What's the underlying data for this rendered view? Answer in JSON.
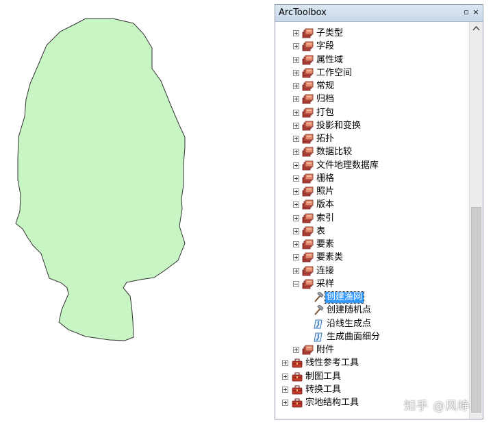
{
  "toolbox": {
    "title": "ArcToolbox",
    "maximize_glyph": "▫",
    "close_glyph": "×"
  },
  "tree": {
    "items": [
      {
        "label": "子类型",
        "level": 1,
        "icon": "toolset-icon",
        "expander": "plus"
      },
      {
        "label": "字段",
        "level": 1,
        "icon": "toolset-icon",
        "expander": "plus"
      },
      {
        "label": "属性域",
        "level": 1,
        "icon": "toolset-icon",
        "expander": "plus"
      },
      {
        "label": "工作空间",
        "level": 1,
        "icon": "toolset-icon",
        "expander": "plus"
      },
      {
        "label": "常规",
        "level": 1,
        "icon": "toolset-icon",
        "expander": "plus"
      },
      {
        "label": "归档",
        "level": 1,
        "icon": "toolset-icon",
        "expander": "plus"
      },
      {
        "label": "打包",
        "level": 1,
        "icon": "toolset-icon",
        "expander": "plus"
      },
      {
        "label": "投影和变换",
        "level": 1,
        "icon": "toolset-icon",
        "expander": "plus"
      },
      {
        "label": "拓扑",
        "level": 1,
        "icon": "toolset-icon",
        "expander": "plus"
      },
      {
        "label": "数据比较",
        "level": 1,
        "icon": "toolset-icon",
        "expander": "plus"
      },
      {
        "label": "文件地理数据库",
        "level": 1,
        "icon": "toolset-icon",
        "expander": "plus"
      },
      {
        "label": "栅格",
        "level": 1,
        "icon": "toolset-icon",
        "expander": "plus"
      },
      {
        "label": "照片",
        "level": 1,
        "icon": "toolset-icon",
        "expander": "plus"
      },
      {
        "label": "版本",
        "level": 1,
        "icon": "toolset-icon",
        "expander": "plus"
      },
      {
        "label": "索引",
        "level": 1,
        "icon": "toolset-icon",
        "expander": "plus"
      },
      {
        "label": "表",
        "level": 1,
        "icon": "toolset-icon",
        "expander": "plus"
      },
      {
        "label": "要素",
        "level": 1,
        "icon": "toolset-icon",
        "expander": "plus"
      },
      {
        "label": "要素类",
        "level": 1,
        "icon": "toolset-icon",
        "expander": "plus"
      },
      {
        "label": "连接",
        "level": 1,
        "icon": "toolset-icon",
        "expander": "plus"
      },
      {
        "label": "采样",
        "level": 1,
        "icon": "toolset-icon",
        "expander": "minus"
      },
      {
        "label": "创建渔网",
        "level": 2,
        "icon": "hammer-tool-icon",
        "expander": "none",
        "selected": true
      },
      {
        "label": "创建随机点",
        "level": 2,
        "icon": "hammer-tool-icon",
        "expander": "none"
      },
      {
        "label": "沿线生成点",
        "level": 2,
        "icon": "script-tool-icon",
        "expander": "none"
      },
      {
        "label": "生成曲面细分",
        "level": 2,
        "icon": "script-tool-icon",
        "expander": "none"
      },
      {
        "label": "附件",
        "level": 1,
        "icon": "toolset-icon",
        "expander": "plus"
      },
      {
        "label": "线性参考工具",
        "level": 0,
        "icon": "toolbox-icon",
        "expander": "plus"
      },
      {
        "label": "制图工具",
        "level": 0,
        "icon": "toolbox-icon",
        "expander": "plus"
      },
      {
        "label": "转换工具",
        "level": 0,
        "icon": "toolbox-icon",
        "expander": "plus"
      },
      {
        "label": "宗地结构工具",
        "level": 0,
        "icon": "toolbox-icon",
        "expander": "plus"
      }
    ]
  },
  "map": {
    "polygon_fill": "#c8f5c4",
    "polygon_stroke": "#333333"
  },
  "colors": {
    "selection": "#3399ff",
    "toolbox_red": "#c0392b"
  },
  "watermark": "知乎 @风峥"
}
